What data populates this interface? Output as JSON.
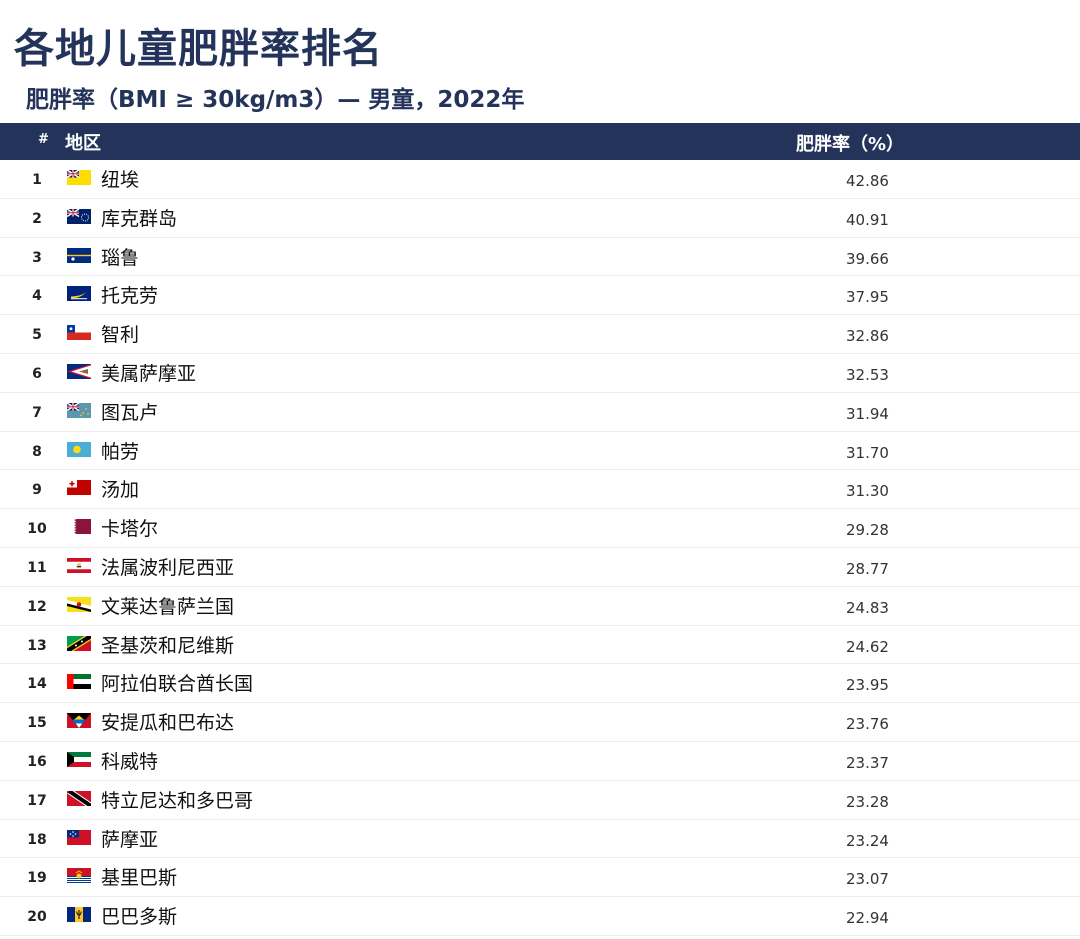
{
  "title": "各地儿童肥胖率排名",
  "subtitle": "肥胖率（BMI ≥ 30kg/m3）— 男童，2022年",
  "header": {
    "rank": "#",
    "region": "地区",
    "value": "肥胖率（%）"
  },
  "chart_data": {
    "type": "table",
    "columns": [
      "#",
      "地区",
      "肥胖率（%）"
    ],
    "rows": [
      {
        "rank": "1",
        "region": "纽埃",
        "value": "42.86",
        "flag": "niue-flag-icon"
      },
      {
        "rank": "2",
        "region": "库克群岛",
        "value": "40.91",
        "flag": "cook-islands-flag-icon"
      },
      {
        "rank": "3",
        "region": "瑙鲁",
        "value": "39.66",
        "flag": "nauru-flag-icon"
      },
      {
        "rank": "4",
        "region": "托克劳",
        "value": "37.95",
        "flag": "tokelau-flag-icon"
      },
      {
        "rank": "5",
        "region": "智利",
        "value": "32.86",
        "flag": "chile-flag-icon"
      },
      {
        "rank": "6",
        "region": "美属萨摩亚",
        "value": "32.53",
        "flag": "american-samoa-flag-icon"
      },
      {
        "rank": "7",
        "region": "图瓦卢",
        "value": "31.94",
        "flag": "tuvalu-flag-icon"
      },
      {
        "rank": "8",
        "region": "帕劳",
        "value": "31.70",
        "flag": "palau-flag-icon"
      },
      {
        "rank": "9",
        "region": "汤加",
        "value": "31.30",
        "flag": "tonga-flag-icon"
      },
      {
        "rank": "10",
        "region": "卡塔尔",
        "value": "29.28",
        "flag": "qatar-flag-icon"
      },
      {
        "rank": "11",
        "region": "法属波利尼西亚",
        "value": "28.77",
        "flag": "french-polynesia-flag-icon"
      },
      {
        "rank": "12",
        "region": "文莱达鲁萨兰国",
        "value": "24.83",
        "flag": "brunei-flag-icon"
      },
      {
        "rank": "13",
        "region": "圣基茨和尼维斯",
        "value": "24.62",
        "flag": "saint-kitts-nevis-flag-icon"
      },
      {
        "rank": "14",
        "region": "阿拉伯联合酋长国",
        "value": "23.95",
        "flag": "uae-flag-icon"
      },
      {
        "rank": "15",
        "region": "安提瓜和巴布达",
        "value": "23.76",
        "flag": "antigua-barbuda-flag-icon"
      },
      {
        "rank": "16",
        "region": "科威特",
        "value": "23.37",
        "flag": "kuwait-flag-icon"
      },
      {
        "rank": "17",
        "region": "特立尼达和多巴哥",
        "value": "23.28",
        "flag": "trinidad-tobago-flag-icon"
      },
      {
        "rank": "18",
        "region": "萨摩亚",
        "value": "23.24",
        "flag": "samoa-flag-icon"
      },
      {
        "rank": "19",
        "region": "基里巴斯",
        "value": "23.07",
        "flag": "kiribati-flag-icon"
      },
      {
        "rank": "20",
        "region": "巴巴多斯",
        "value": "22.94",
        "flag": "barbados-flag-icon"
      }
    ]
  },
  "colors": {
    "title": "#23335a",
    "header_bg": "#23335a",
    "header_text": "#ffffff",
    "row_border": "#ececec"
  }
}
